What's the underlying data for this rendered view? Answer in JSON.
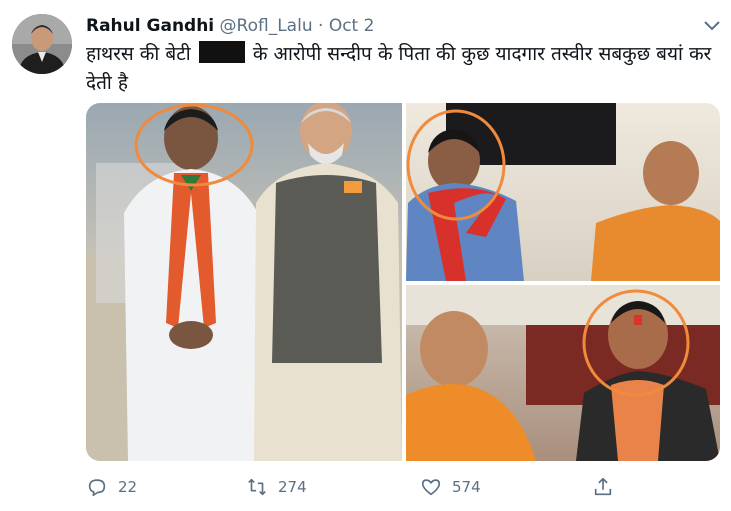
{
  "tweet": {
    "author_name": "Rahul Gandhi",
    "handle": "@Rofl_Lalu",
    "separator": "·",
    "date": "Oct 2",
    "text_part1": "हाथरस की बेटी",
    "text_part2": "के आरोपी सन्दीप के पिता की कुछ यादगार तस्वीर सबकुछ बयां कर देती है"
  },
  "actions": {
    "replies": "22",
    "retweets": "274",
    "likes": "574"
  },
  "icons": {
    "more": "chevron-down-icon",
    "reply": "reply-icon",
    "retweet": "retweet-icon",
    "like": "heart-icon",
    "share": "share-icon"
  },
  "colors": {
    "text": "#0f1419",
    "secondary": "#5b7083",
    "highlight_circle": "#f08a3c"
  }
}
